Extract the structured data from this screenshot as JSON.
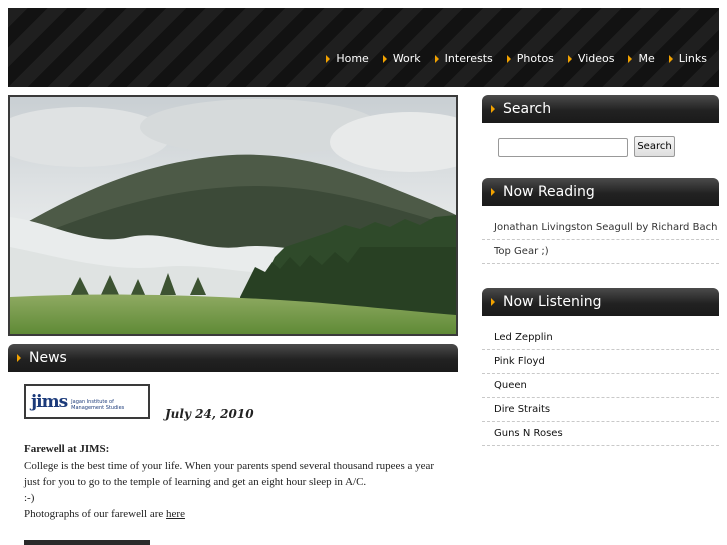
{
  "nav": {
    "items": [
      "Home",
      "Work",
      "Interests",
      "Photos",
      "Videos",
      "Me",
      "Links"
    ]
  },
  "news": {
    "heading": "News",
    "logo_text": "jims",
    "logo_subtext": "Jagan Institute of Management Studies",
    "date": "July 24, 2010",
    "title": "Farewell at JIMS:",
    "line1": "College is the best time of your life. When your parents spend several thousand rupees a year just for you to go to the temple of learning and get an eight hour sleep in A/C.",
    "line2": ":-)",
    "line3_prefix": "Photographs of our farewell are ",
    "line3_link": "here"
  },
  "search": {
    "heading": "Search",
    "input_value": "",
    "button_label": "Search"
  },
  "reading": {
    "heading": "Now Reading",
    "items": [
      "Jonathan Livingston Seagull by Richard Bach",
      "Top Gear ;)"
    ]
  },
  "listening": {
    "heading": "Now Listening",
    "items": [
      "Led Zepplin",
      "Pink Floyd",
      "Queen",
      "Dire Straits",
      "Guns N Roses"
    ]
  },
  "colors": {
    "accent": "#f2a200",
    "header_bg": "#151515",
    "bar_dark": "#222222"
  },
  "icons": {
    "nav_bullet": "triangle-right-icon",
    "section_bullet": "triangle-right-icon"
  }
}
